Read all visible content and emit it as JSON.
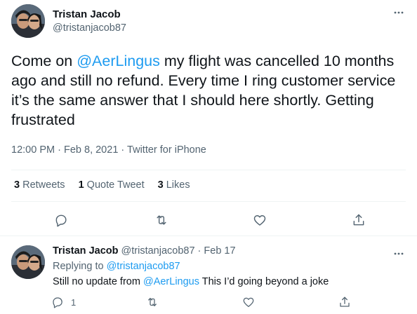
{
  "tweet": {
    "author_name": "Tristan Jacob",
    "author_handle": "@tristanjacob87",
    "text_before": "Come on ",
    "mention": "@AerLingus",
    "text_after": " my flight was cancelled 10 months ago and still no refund. Every time I ring customer service it’s the same answer that I should here shortly. Getting frustrated",
    "time": "12:00 PM",
    "date": "Feb 8, 2021",
    "source": "Twitter for iPhone",
    "separator": "·",
    "stats": {
      "retweets_count": "3",
      "retweets_label": "Retweets",
      "quotes_count": "1",
      "quotes_label": "Quote Tweet",
      "likes_count": "3",
      "likes_label": "Likes"
    },
    "more_icon": "more-horizontal-icon"
  },
  "reply": {
    "author_name": "Tristan Jacob",
    "author_handle": "@tristanjacob87",
    "date": "Feb 17",
    "replying_prefix": "Replying to",
    "replying_to": "@tristanjacob87",
    "text_before": "Still no update from ",
    "mention": "@AerLingus",
    "text_after": " This I’d going beyond a joke",
    "reply_count": "1"
  },
  "colors": {
    "link": "#1d9bf0",
    "secondary_text": "#536471",
    "primary_text": "#0f1419",
    "divider": "#eff3f4"
  }
}
